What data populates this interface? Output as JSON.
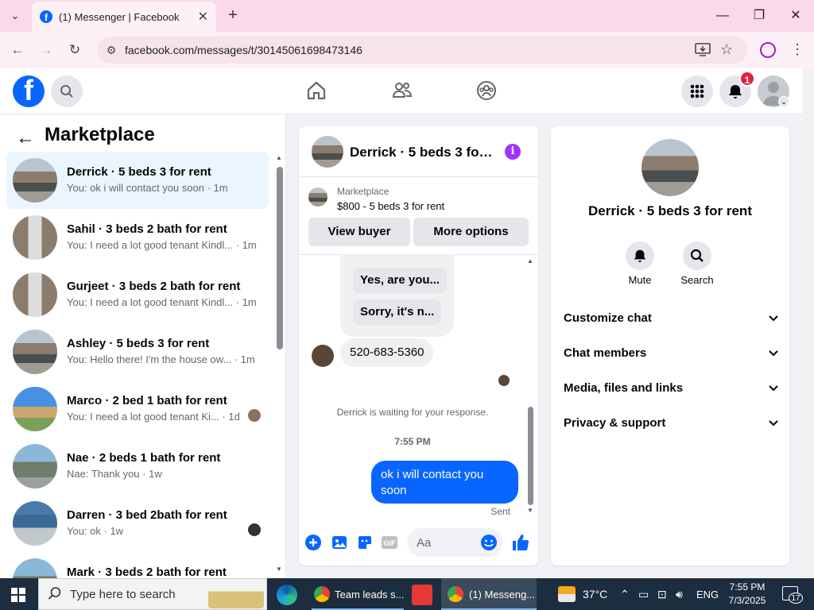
{
  "browser": {
    "tab_title": "(1) Messenger | Facebook",
    "url": "facebook.com/messages/t/30145061698473146"
  },
  "header": {
    "notification_count": "1"
  },
  "left_panel": {
    "title": "Marketplace",
    "conversations": [
      {
        "name": "Derrick · 5 beds 3 for rent",
        "preview": "You: ok i will contact you soon · 1m"
      },
      {
        "name": "Sahil · 3 beds 2 bath for rent",
        "preview": "You: I need a lot good tenant Kindl... · 1m"
      },
      {
        "name": "Gurjeet · 3 beds 2 bath for rent",
        "preview": "You: I need a lot good tenant Kindl... · 1m"
      },
      {
        "name": "Ashley · 5 beds 3 for rent",
        "preview": "You: Hello there! I'm the house ow... · 1m"
      },
      {
        "name": "Marco · 2 bed 1 bath for rent",
        "preview": "You: I need a lot good tenant Ki... · 1d"
      },
      {
        "name": "Nae · 2 beds 1 bath for rent",
        "preview": "Nae: Thank you · 1w"
      },
      {
        "name": "Darren · 3 bed 2bath for rent",
        "preview": "You: ok · 1w"
      },
      {
        "name": "Mark · 3 beds 2 bath for rent",
        "preview": ""
      }
    ]
  },
  "chat": {
    "title": "Derrick · 5 beds 3 for...",
    "marketplace_label": "Marketplace",
    "listing": "$800 - 5 beds 3 for rent",
    "view_buyer": "View buyer",
    "more_options": "More options",
    "quick_replies": [
      "Yes, are you...",
      "Sorry, it's n..."
    ],
    "received_message": "520-683-5360",
    "waiting_text": "Derrick is waiting for your response.",
    "timestamp": "7:55 PM",
    "sent_message": "ok i will contact you soon",
    "sent_status": "Sent",
    "composer_placeholder": "Aa"
  },
  "right_panel": {
    "name": "Derrick · 5 beds 3 for rent",
    "actions": [
      {
        "label": "Mute"
      },
      {
        "label": "Search"
      }
    ],
    "sections": [
      "Customize chat",
      "Chat members",
      "Media, files and links",
      "Privacy & support"
    ]
  },
  "taskbar": {
    "search_placeholder": "Type here to search",
    "apps": [
      {
        "label": "Team leads s..."
      },
      {
        "label": "(1) Messeng..."
      }
    ],
    "weather": "37°C",
    "language": "ENG",
    "time": "7:55 PM",
    "date": "7/3/2025",
    "notification_count": "17"
  },
  "colors": {
    "accent": "#0866ff",
    "tab_strip": "#fbd8ea",
    "taskbar": "#1c2d3f"
  }
}
